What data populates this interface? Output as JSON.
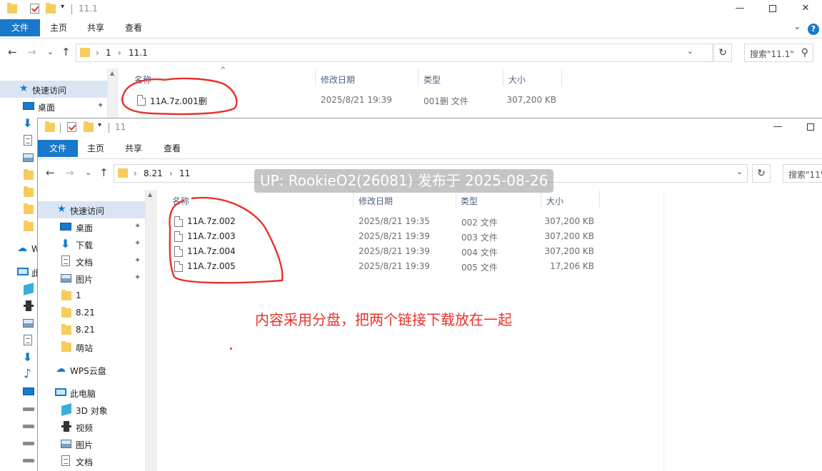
{
  "colors": {
    "accent": "#1979ca",
    "annotation": "#e8322a",
    "folder": "#f7cc5c"
  },
  "back_window": {
    "title": "11.1",
    "qat_arrow": "▾",
    "window_controls": {
      "minimize": "—",
      "close": "✕"
    },
    "ribbon": {
      "tabs": [
        "文件",
        "主页",
        "共享",
        "查看"
      ],
      "collapse": "⌄",
      "help": "?"
    },
    "nav": {
      "back": "←",
      "forward": "→",
      "recent": "⌄",
      "up": "↑",
      "refresh": "↻"
    },
    "breadcrumb": [
      "1",
      "11.1"
    ],
    "crumb_sep": "›",
    "search_placeholder": "搜索\"11.1\"",
    "columns": {
      "name": "名称",
      "date": "修改日期",
      "type": "类型",
      "size": "大小"
    },
    "sort_caret": "^",
    "files": [
      {
        "name": "11A.7z.001删",
        "date": "2025/8/21 19:39",
        "type": "001删 文件",
        "size": "307,200 KB"
      }
    ],
    "sidebar": {
      "quick_access": "快速访问",
      "desktop": "桌面",
      "partial_labels": {
        "wps": "W",
        "pc": "此"
      }
    }
  },
  "front_window": {
    "title": "11",
    "qat_arrow": "▾",
    "ribbon": {
      "tabs": [
        "文件",
        "主页",
        "共享",
        "查看"
      ]
    },
    "nav": {
      "back": "←",
      "forward": "→",
      "recent": "⌄",
      "up": "↑",
      "refresh": "↻"
    },
    "breadcrumb": [
      "8.21",
      "11"
    ],
    "crumb_sep": "›",
    "search_placeholder": "搜索\"11\"",
    "columns": {
      "name": "名称",
      "date": "修改日期",
      "type": "类型",
      "size": "大小"
    },
    "files": [
      {
        "name": "11A.7z.002",
        "date": "2025/8/21 19:35",
        "type": "002 文件",
        "size": "307,200 KB"
      },
      {
        "name": "11A.7z.003",
        "date": "2025/8/21 19:39",
        "type": "003 文件",
        "size": "307,200 KB"
      },
      {
        "name": "11A.7z.004",
        "date": "2025/8/21 19:39",
        "type": "004 文件",
        "size": "307,200 KB"
      },
      {
        "name": "11A.7z.005",
        "date": "2025/8/21 19:39",
        "type": "005 文件",
        "size": "17,206 KB"
      }
    ],
    "sidebar": {
      "quick_access": "快速访问",
      "items": [
        {
          "label": "桌面",
          "icon": "desktop-icon",
          "pinned": true
        },
        {
          "label": "下载",
          "icon": "download-icon",
          "pinned": true
        },
        {
          "label": "文档",
          "icon": "document-icon",
          "pinned": true
        },
        {
          "label": "图片",
          "icon": "pictures-icon",
          "pinned": true
        },
        {
          "label": "1",
          "icon": "folder-icon",
          "pinned": false
        },
        {
          "label": "8.21",
          "icon": "folder-icon",
          "pinned": false
        },
        {
          "label": "8.21",
          "icon": "folder-icon",
          "pinned": false
        },
        {
          "label": "萌站",
          "icon": "folder-icon",
          "pinned": false
        }
      ],
      "wps": "WPS云盘",
      "this_pc": "此电脑",
      "pc_items": [
        {
          "label": "3D 对象",
          "icon": "3d-objects-icon"
        },
        {
          "label": "视频",
          "icon": "videos-icon"
        },
        {
          "label": "图片",
          "icon": "pictures-icon"
        },
        {
          "label": "文档",
          "icon": "document-icon"
        }
      ]
    }
  },
  "overlay": {
    "watermark": "UP: RookieO2(26081) 发布于 2025-08-26",
    "annotation": "内容采用分盘，把两个链接下载放在一起"
  }
}
